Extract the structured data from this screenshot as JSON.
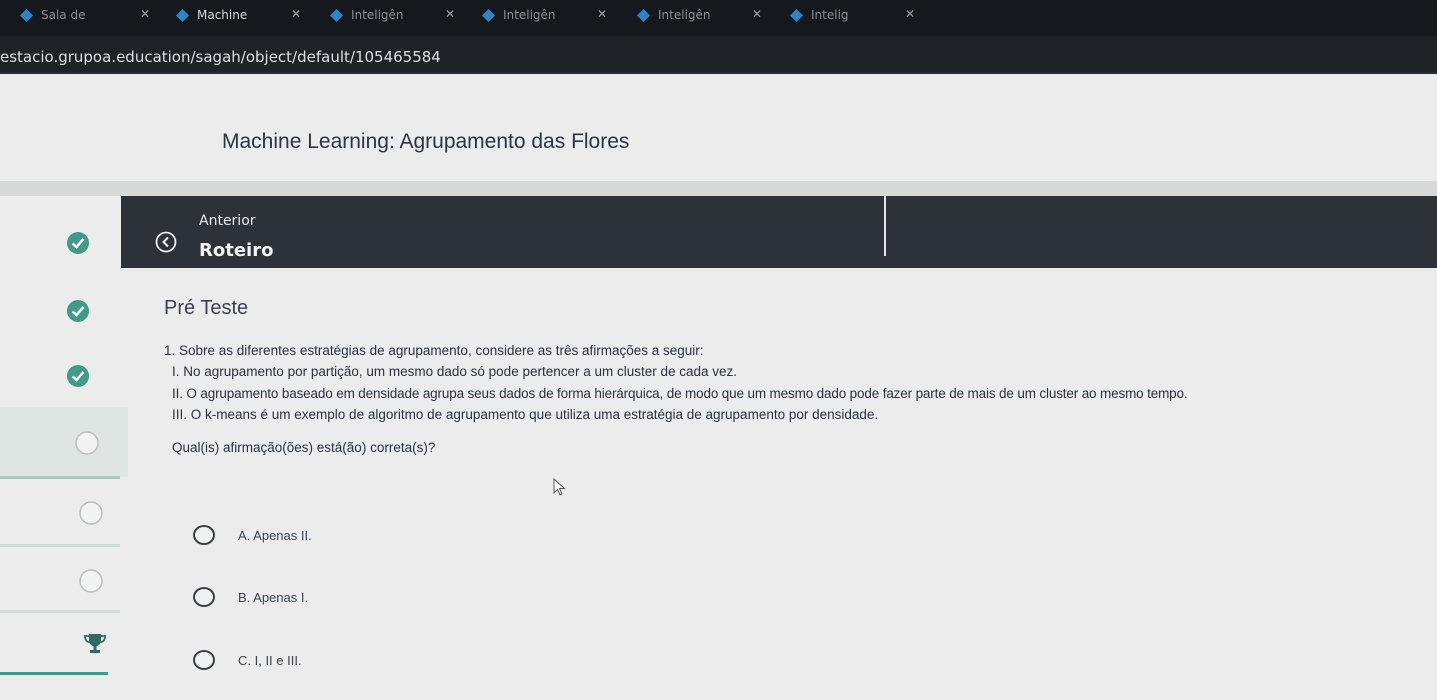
{
  "browser": {
    "tabs": [
      {
        "title": "Sala de"
      },
      {
        "title": "Machine"
      },
      {
        "title": "Inteligên"
      },
      {
        "title": "Inteligên"
      },
      {
        "title": "Inteligên"
      },
      {
        "title": "Intelig"
      }
    ],
    "tab_close_glyph": "✕",
    "url": "estacio.grupoa.education/sagah/object/default/105465584"
  },
  "page": {
    "title": "Machine Learning: Agrupamento das Flores"
  },
  "nav": {
    "previous_label": "Anterior",
    "previous_title": "Roteiro"
  },
  "section": {
    "title": "Pré Teste"
  },
  "question": {
    "text": "1. Sobre as diferentes estratégias de agrupamento, considere as três afirmações a seguir:",
    "statements": [
      "I. No agrupamento por partição, um mesmo dado só pode pertencer a um cluster de cada vez.",
      "II. O agrupamento baseado em densidade agrupa seus dados de forma hierárquica, de modo que um mesmo dado pode fazer parte de mais de um cluster ao mesmo tempo.",
      "III. O k-means é um exemplo de algoritmo de agrupamento que utiliza uma estratégia de agrupamento por densidade."
    ],
    "prompt": "Qual(is) afirmação(ões) está(ão) correta(s)?",
    "options": [
      {
        "label": "A. Apenas II."
      },
      {
        "label": "B. Apenas I."
      },
      {
        "label": "C. I, II e III."
      }
    ]
  },
  "progress_rail": {
    "steps": [
      "completed",
      "completed",
      "completed",
      "pending",
      "pending",
      "pending",
      "trophy"
    ]
  },
  "colors": {
    "accent": "#3f9a86",
    "dark_nav": "#2c3238",
    "background": "#ebeceb"
  }
}
